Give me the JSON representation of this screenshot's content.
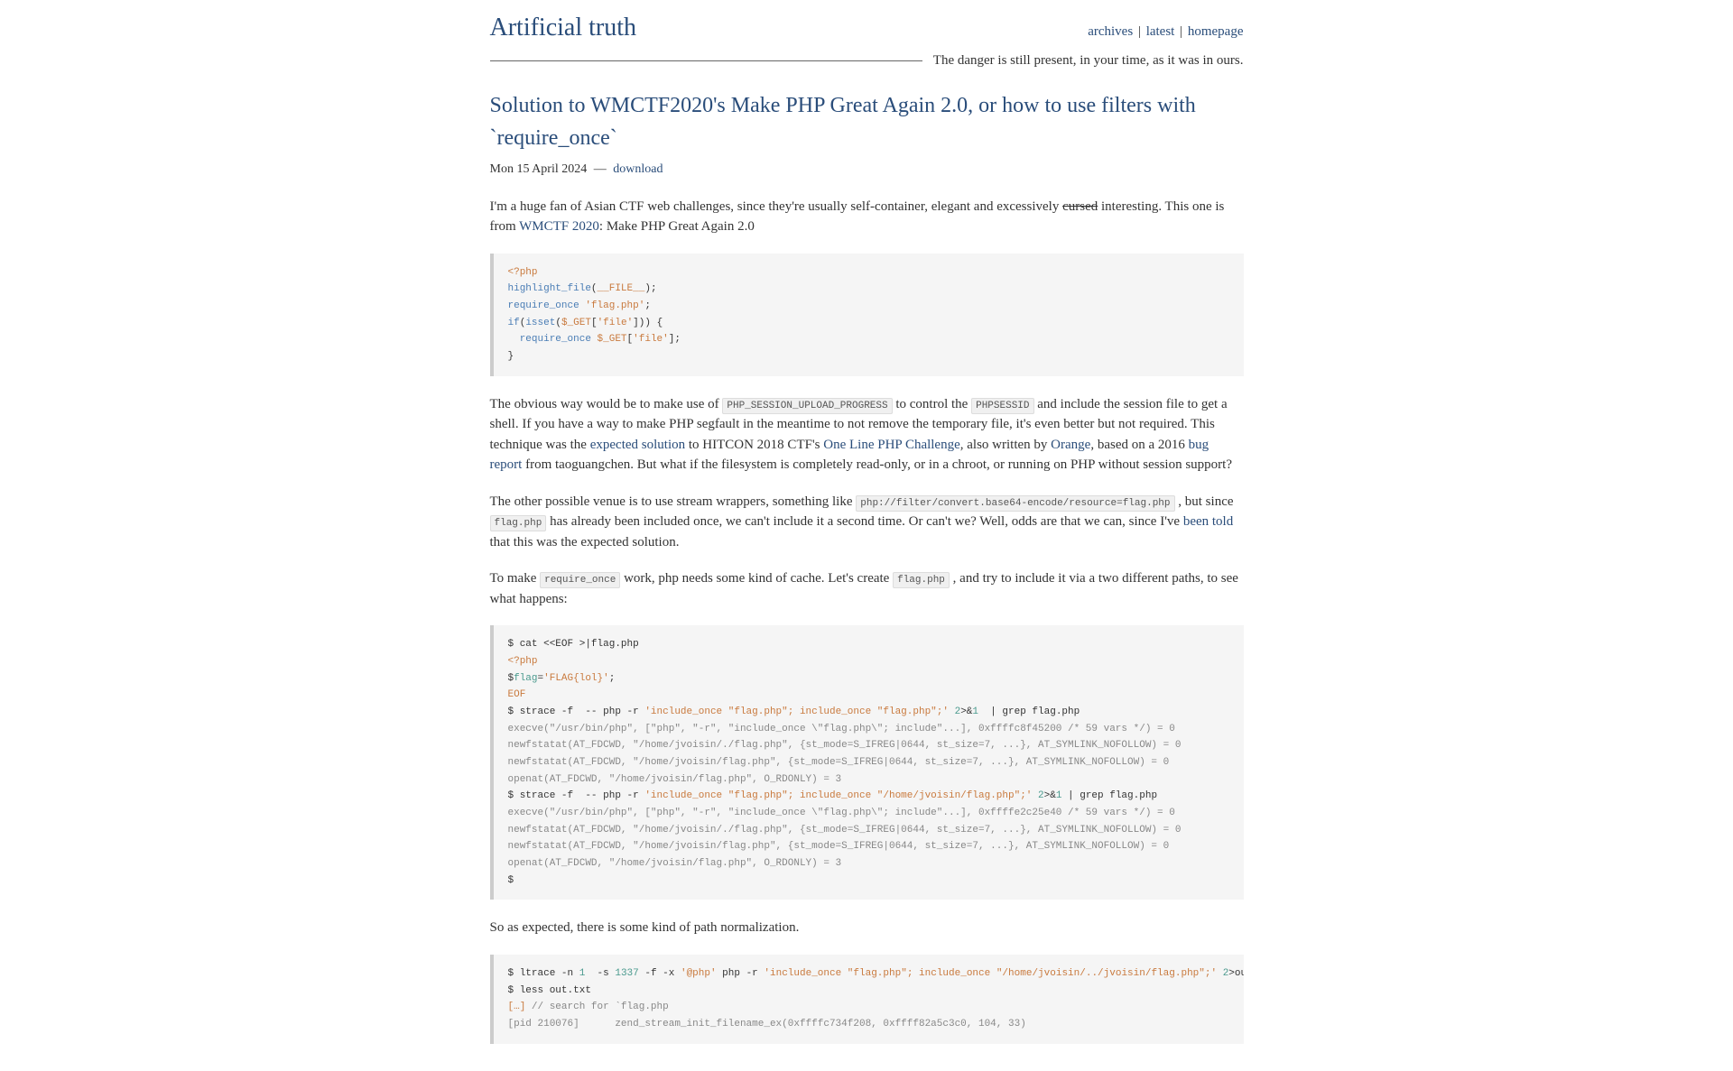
{
  "site": {
    "title": "Artificial truth",
    "nav": {
      "archives": "archives",
      "latest": "latest",
      "homepage": "homepage"
    },
    "tagline": "The danger is still present, in your time, as it was in ours."
  },
  "article": {
    "title": "Solution to WMCTF2020's Make PHP Great Again 2.0, or how to use filters with `require_once`",
    "date": "Mon 15 April 2024",
    "download": "download"
  },
  "para1": {
    "t1": "I'm a huge fan of Asian CTF web challenges, since they're usually self-container, elegant and excessively ",
    "strike": "cursed",
    "t2": " interesting. This one is from ",
    "link": "WMCTF 2020",
    "t3": ": Make PHP Great Again 2.0"
  },
  "code1": {
    "l1a": "<?php",
    "l2a": "highlight_file",
    "l2b": "(",
    "l2c": "__FILE__",
    "l2d": ");",
    "l3a": "require_once",
    "l3b": " ",
    "l3c": "'flag.php'",
    "l3d": ";",
    "l4a": "if",
    "l4b": "(",
    "l4c": "isset",
    "l4d": "(",
    "l4e": "$_GET",
    "l4f": "[",
    "l4g": "'file'",
    "l4h": "])) {",
    "l5a": "  require_once",
    "l5b": " ",
    "l5c": "$_GET",
    "l5d": "[",
    "l5e": "'file'",
    "l5f": "];",
    "l6a": "}"
  },
  "para2": {
    "t1": "The obvious way would be to make use of ",
    "code1": "PHP_SESSION_UPLOAD_PROGRESS",
    "t2": " to control the ",
    "code2": "PHPSESSID",
    "t3": " and include the session file to get a shell. If you have a way to make PHP segfault in the meantime to not remove the temporary file, it's even better but not required. This technique was the ",
    "link1": "expected solution",
    "t4": " to HITCON 2018 CTF's ",
    "link2": "One Line PHP Challenge",
    "t5": ", also written by ",
    "link3": "Orange",
    "t6": ", based on a 2016 ",
    "link4": "bug report",
    "t7": " from taoguangchen. But what if the filesystem is completely read-only, or in a chroot, or running on PHP without session support?"
  },
  "para3": {
    "t1": "The other possible venue is to use stream wrappers, something like ",
    "code1": "php://filter/convert.base64-encode/resource=flag.php",
    "t2": " , but since ",
    "code2": "flag.php",
    "t3": " has already been included once, we can't include it a second time. Or can't we? Well, odds are that we can, since I've ",
    "link1": "been told",
    "t4": " that this was the expected solution."
  },
  "para4": {
    "t1": "To make ",
    "code1": "require_once",
    "t2": " work, php needs some kind of cache. Let's create ",
    "code2": "flag.php",
    "t3": " , and try to include it via a two different paths, to see what happens:"
  },
  "code2": {
    "l1": "$ cat <<EOF >|flag.php",
    "l2": "<?php",
    "l3a": "$",
    "l3b": "flag",
    "l3c": "=",
    "l3d": "'FLAG{lol}'",
    "l3e": ";",
    "l4": "EOF",
    "l5a": "$ strace -f  -- php -r ",
    "l5b": "'include_once \"flag.php\"; include_once \"flag.php\";'",
    "l5c": " 2",
    "l5d": ">&",
    "l5e": "1",
    "l5f": "  | grep flag.php",
    "l6": "execve(\"/usr/bin/php\", [\"php\", \"-r\", \"include_once \\\"flag.php\\\"; include\"...], 0xffffc8f45200 /* 59 vars */) = 0",
    "l7": "newfstatat(AT_FDCWD, \"/home/jvoisin/./flag.php\", {st_mode=S_IFREG|0644, st_size=7, ...}, AT_SYMLINK_NOFOLLOW) = 0",
    "l8": "newfstatat(AT_FDCWD, \"/home/jvoisin/flag.php\", {st_mode=S_IFREG|0644, st_size=7, ...}, AT_SYMLINK_NOFOLLOW) = 0",
    "l9": "openat(AT_FDCWD, \"/home/jvoisin/flag.php\", O_RDONLY) = 3",
    "l10a": "$ strace -f  -- php -r ",
    "l10b": "'include_once \"flag.php\"; include_once \"/home/jvoisin/flag.php\";'",
    "l10c": " 2",
    "l10d": ">&",
    "l10e": "1",
    "l10f": " | grep flag.php",
    "l11": "execve(\"/usr/bin/php\", [\"php\", \"-r\", \"include_once \\\"flag.php\\\"; include\"...], 0xffffe2c25e40 /* 59 vars */) = 0",
    "l12": "newfstatat(AT_FDCWD, \"/home/jvoisin/./flag.php\", {st_mode=S_IFREG|0644, st_size=7, ...}, AT_SYMLINK_NOFOLLOW) = 0",
    "l13": "newfstatat(AT_FDCWD, \"/home/jvoisin/flag.php\", {st_mode=S_IFREG|0644, st_size=7, ...}, AT_SYMLINK_NOFOLLOW) = 0",
    "l14": "openat(AT_FDCWD, \"/home/jvoisin/flag.php\", O_RDONLY) = 3",
    "l15": "$"
  },
  "para5": {
    "t1": "So as expected, there is some kind of path normalization."
  },
  "code3": {
    "l1a": "$ ltrace -n ",
    "l1b": "1",
    "l1c": "  -s ",
    "l1d": "1337",
    "l1e": " -f -x ",
    "l1f": "'@php'",
    "l1g": " php -r ",
    "l1h": "'include_once \"flag.php\"; include_once \"/home/jvoisin/../jvoisin/flag.php\";'",
    "l1i": " ",
    "l1j": "2",
    "l1k": ">out.txt",
    "l2": "$ less out.txt",
    "l3a": "[…] ",
    "l3b": "// search for `flag.php",
    "l4": "[pid 210076]      zend_stream_init_filename_ex(0xffffc734f208, 0xffff82a5c3c0, 104, 33)"
  }
}
